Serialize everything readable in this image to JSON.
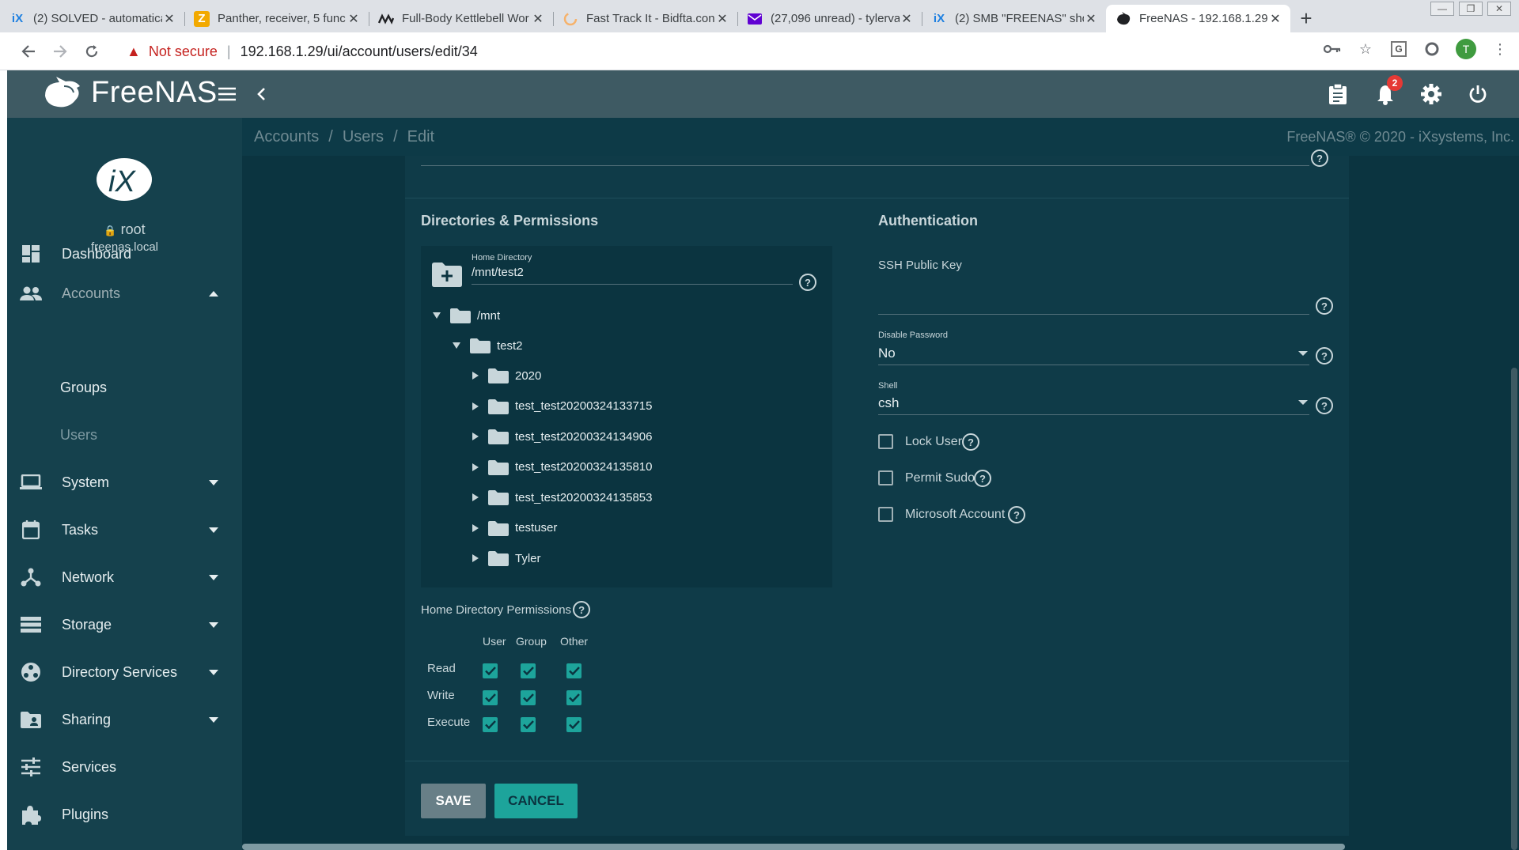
{
  "browser": {
    "tabs": [
      {
        "title": "(2) SOLVED - automatica",
        "favicon": "ix-icon",
        "favicon_color": "#1d7fe0",
        "active": false
      },
      {
        "title": "Panther, receiver, 5 func",
        "favicon": "z-icon",
        "favicon_color": "#f2a900",
        "active": false
      },
      {
        "title": "Full-Body Kettlebell Wor",
        "favicon": "wave-icon",
        "favicon_color": "#202124",
        "active": false
      },
      {
        "title": "Fast Track It - Bidfta.con",
        "favicon": "loading-icon",
        "favicon_color": "#f6b26b",
        "active": false
      },
      {
        "title": "(27,096 unread) - tylerva",
        "favicon": "mail-icon",
        "favicon_color": "#6001d2",
        "active": false
      },
      {
        "title": "(2) SMB \"FREENAS\" sho",
        "favicon": "ix-icon",
        "favicon_color": "#1d7fe0",
        "active": false
      },
      {
        "title": "FreeNAS - 192.168.1.29",
        "favicon": "freenas-icon",
        "favicon_color": "#202124",
        "active": true
      }
    ],
    "new_tab": "+",
    "security_label": "Not secure",
    "url": "192.168.1.29/ui/account/users/edit/34",
    "profile_initial": "T"
  },
  "app": {
    "logo_text": "FreeNAS",
    "notification_count": "2",
    "breadcrumb": [
      "Accounts",
      "Users",
      "Edit"
    ],
    "copyright": "FreeNAS® © 2020 - iXsystems, Inc."
  },
  "sidebar": {
    "user": "root",
    "host": "freenas.local",
    "items": [
      {
        "label": "Dashboard",
        "icon": "dashboard-icon"
      },
      {
        "label": "Accounts",
        "icon": "accounts-icon",
        "expanded": true
      },
      {
        "label": "System",
        "icon": "laptop-icon"
      },
      {
        "label": "Tasks",
        "icon": "calendar-icon"
      },
      {
        "label": "Network",
        "icon": "network-icon"
      },
      {
        "label": "Storage",
        "icon": "storage-icon"
      },
      {
        "label": "Directory Services",
        "icon": "directory-services-icon"
      },
      {
        "label": "Sharing",
        "icon": "sharing-icon"
      },
      {
        "label": "Services",
        "icon": "services-icon"
      },
      {
        "label": "Plugins",
        "icon": "plugins-icon"
      }
    ],
    "subitems": [
      "Groups",
      "Users"
    ]
  },
  "form": {
    "dir_section_title": "Directories & Permissions",
    "auth_section_title": "Authentication",
    "home_dir_caption": "Home Directory",
    "home_dir_value": "/mnt/test2",
    "tree": {
      "root": "/mnt",
      "child": "test2",
      "folders": [
        "2020",
        "test_test20200324133715",
        "test_test20200324134906",
        "test_test20200324135810",
        "test_test20200324135853",
        "testuser",
        "Tyler"
      ]
    },
    "permissions_label": "Home Directory Permissions",
    "permission_columns": [
      "User",
      "Group",
      "Other"
    ],
    "permission_rows": [
      "Read",
      "Write",
      "Execute"
    ],
    "permissions_checked": true,
    "ssh_label": "SSH Public Key",
    "disable_password_caption": "Disable Password",
    "disable_password_value": "No",
    "shell_caption": "Shell",
    "shell_value": "csh",
    "checkboxes": [
      "Lock User",
      "Permit Sudo",
      "Microsoft Account"
    ],
    "save_label": "SAVE",
    "cancel_label": "CANCEL"
  },
  "colors": {
    "accent": "#1da49b",
    "header": "#3e5a63",
    "sidebar": "#15414d",
    "background": "#0b3440",
    "danger": "#e53935"
  }
}
